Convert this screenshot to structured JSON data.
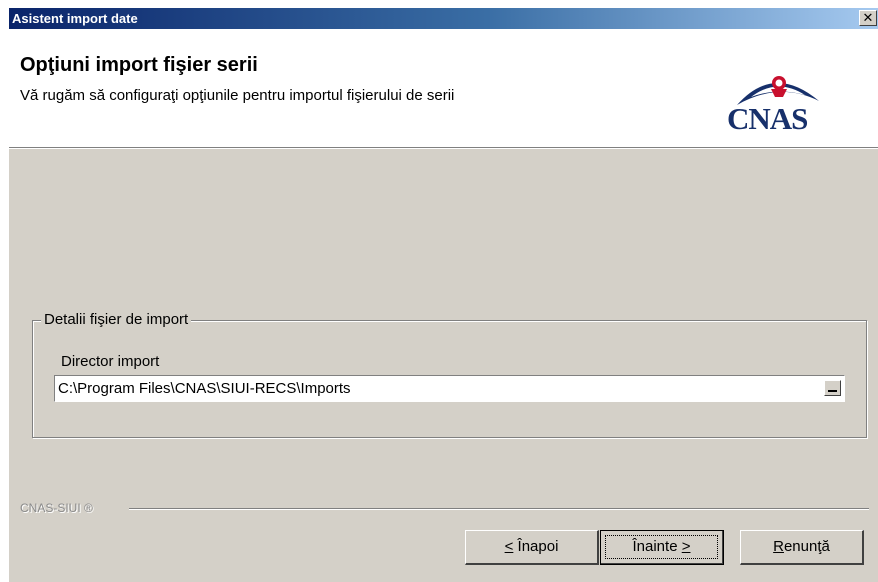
{
  "window": {
    "title": "Asistent import date",
    "close_label": "✕"
  },
  "header": {
    "title": "Opţiuni import fişier serii",
    "subtitle": "Vă rugăm să configuraţi opţiunile pentru importul fişierului de serii",
    "logo_text": "CNAS",
    "logo_colors": {
      "primary": "#17306b",
      "accent": "#c8102e"
    }
  },
  "group": {
    "legend": "Detalii fişier de import",
    "director_label": "Director import",
    "director_value": "C:\\Program Files\\CNAS\\SIUI-RECS\\Imports",
    "browse_icon": "ellipsis-icon"
  },
  "footer": {
    "brand": "CNAS-SIUI ®"
  },
  "buttons": {
    "back": {
      "mnemonic": "<",
      "label": " Înapoi"
    },
    "next": {
      "label": "Înainte ",
      "mnemonic": ">"
    },
    "cancel": {
      "mnemonic": "R",
      "label": "enunţă"
    }
  }
}
